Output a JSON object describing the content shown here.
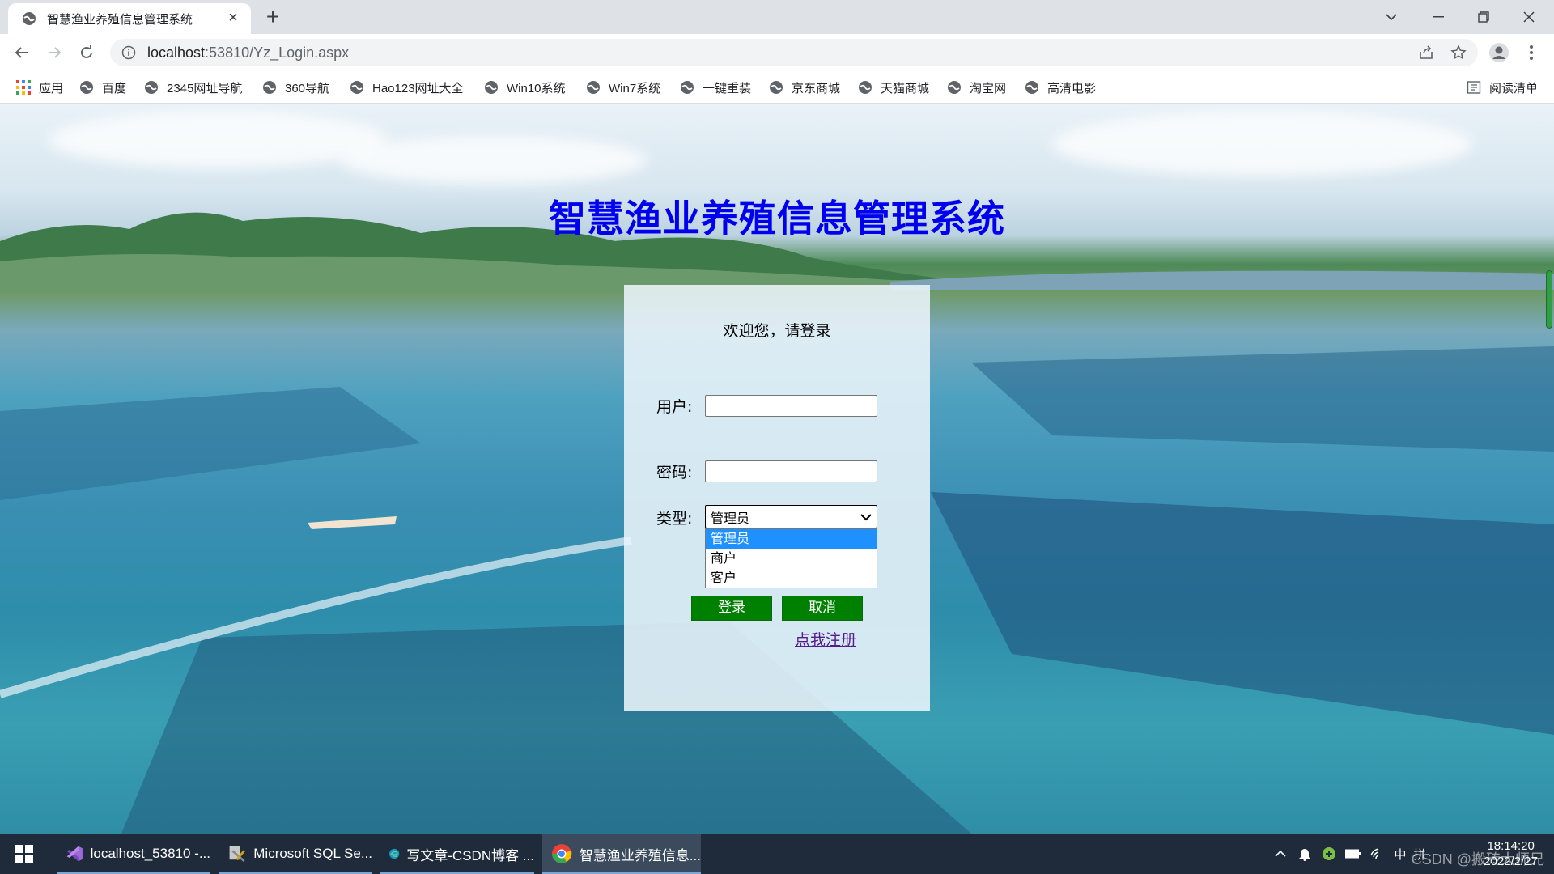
{
  "browser": {
    "tab_title": "智慧渔业养殖信息管理系统",
    "url_host": "localhost",
    "url_rest": ":53810/Yz_Login.aspx",
    "bookmarks": [
      {
        "label": "应用",
        "icon": "apps-grid-icon"
      },
      {
        "label": "百度",
        "icon": "globe-icon"
      },
      {
        "label": "2345网址导航",
        "icon": "globe-icon"
      },
      {
        "label": "360导航",
        "icon": "globe-icon"
      },
      {
        "label": "Hao123网址大全",
        "icon": "globe-icon"
      },
      {
        "label": "Win10系统",
        "icon": "globe-icon"
      },
      {
        "label": "Win7系统",
        "icon": "globe-icon"
      },
      {
        "label": "一键重装",
        "icon": "globe-icon"
      },
      {
        "label": "京东商城",
        "icon": "globe-icon"
      },
      {
        "label": "天猫商城",
        "icon": "globe-icon"
      },
      {
        "label": "淘宝网",
        "icon": "globe-icon"
      },
      {
        "label": "高清电影",
        "icon": "globe-icon"
      }
    ],
    "reading_list": "阅读清单"
  },
  "page": {
    "title": "智慧渔业养殖信息管理系统",
    "welcome": "欢迎您，请登录",
    "user_label": "用户:",
    "user_value": "",
    "password_label": "密码:",
    "password_value": "",
    "type_label": "类型:",
    "type_selected": "管理员",
    "type_options": [
      "管理员",
      "商户",
      "客户"
    ],
    "login_button": "登录",
    "cancel_button": "取消",
    "register_link": "点我注册"
  },
  "taskbar": {
    "apps": [
      {
        "label": "localhost_53810 -...",
        "icon": "visual-studio-icon"
      },
      {
        "label": "Microsoft SQL Se...",
        "icon": "sql-server-icon"
      },
      {
        "label": "写文章-CSDN博客 ...",
        "icon": "edge-icon"
      },
      {
        "label": "智慧渔业养殖信息...",
        "icon": "chrome-icon"
      }
    ],
    "time": "18:14:20",
    "date": "2022/2/27",
    "watermark": "CSDN @搬砖大师兄",
    "ime": "中",
    "ime2": "拼"
  },
  "colors": {
    "title_blue": "#0000ee",
    "button_green": "#008000",
    "selected_option": "#1e90ff",
    "link_purple": "#551a8b"
  }
}
